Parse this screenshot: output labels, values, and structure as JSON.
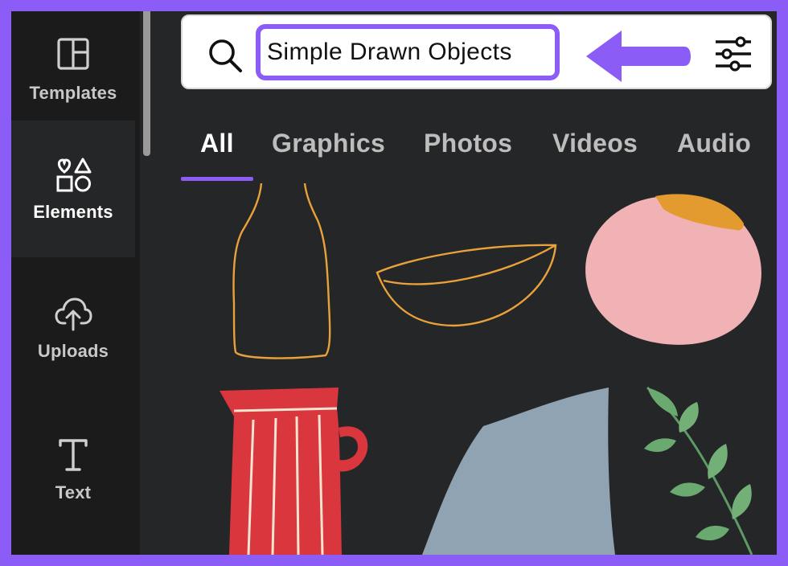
{
  "sidebar": {
    "items": [
      {
        "label": "Templates",
        "icon": "templates-icon"
      },
      {
        "label": "Elements",
        "icon": "elements-icon"
      },
      {
        "label": "Uploads",
        "icon": "uploads-icon"
      },
      {
        "label": "Text",
        "icon": "text-icon"
      }
    ],
    "active": "Elements"
  },
  "search": {
    "query": "Simple Drawn Objects"
  },
  "tabs": [
    {
      "label": "All"
    },
    {
      "label": "Graphics"
    },
    {
      "label": "Photos"
    },
    {
      "label": "Videos"
    },
    {
      "label": "Audio"
    }
  ],
  "active_tab": "All",
  "colors": {
    "accent": "#8b5cf6",
    "panel_bg": "#252627",
    "sidebar_bg": "#1b1b1c",
    "outline_orange": "#e9a23b",
    "pink": "#f1b2b5",
    "red": "#d9363e",
    "slate": "#8fa3b3",
    "leaf_green": "#6aa96f"
  },
  "results": [
    {
      "icon": "bottle-outline-icon"
    },
    {
      "icon": "bowl-outline-icon"
    },
    {
      "icon": "pink-blob-icon"
    },
    {
      "icon": "red-pitcher-icon"
    },
    {
      "icon": "slate-shape-icon"
    },
    {
      "icon": "leaf-branch-icon"
    }
  ]
}
